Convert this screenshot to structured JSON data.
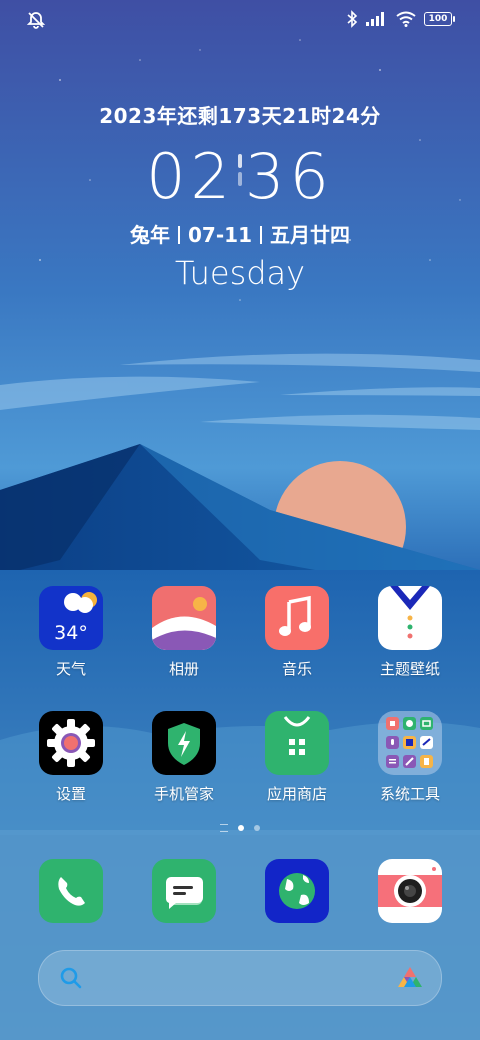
{
  "status_bar": {
    "left_icon": "mute-icon",
    "right_icons": [
      "bluetooth-icon",
      "signal-icon",
      "wifi-icon"
    ],
    "battery_level": "100"
  },
  "clock_widget": {
    "countdown": "2023年还剩173天21时24分",
    "hour": "02",
    "minute": "36",
    "zodiac_year": "兔年",
    "date": "07-11",
    "lunar_date": "五月廿四",
    "weekday": "Tuesday"
  },
  "apps_row1": [
    {
      "label": "天气",
      "icon": "weather-icon",
      "temp": "34°"
    },
    {
      "label": "相册",
      "icon": "gallery-icon"
    },
    {
      "label": "音乐",
      "icon": "music-icon"
    },
    {
      "label": "主题壁纸",
      "icon": "theme-icon"
    }
  ],
  "apps_row2": [
    {
      "label": "设置",
      "icon": "settings-icon"
    },
    {
      "label": "手机管家",
      "icon": "phone-manager-icon"
    },
    {
      "label": "应用商店",
      "icon": "app-store-icon"
    },
    {
      "label": "系统工具",
      "icon": "system-tools-folder-icon"
    }
  ],
  "page_indicator": {
    "pages": 2,
    "active": 1
  },
  "dock": [
    {
      "icon": "phone-icon"
    },
    {
      "icon": "messages-icon"
    },
    {
      "icon": "browser-icon"
    },
    {
      "icon": "camera-icon"
    }
  ],
  "search_bar": {
    "left_icon": "search-icon",
    "right_icon": "assistant-icon"
  },
  "colors": {
    "sky_top": "#3d5aa8",
    "sky_mid": "#2f78c0",
    "mountain": "#0d4a94",
    "sun": "#e8a890",
    "weather_bg": "#1233c9",
    "gallery_bg": "#f0716f",
    "music_bg": "#f86f6a",
    "green_bg": "#2fb36e",
    "browser_bg": "#1225c8"
  }
}
